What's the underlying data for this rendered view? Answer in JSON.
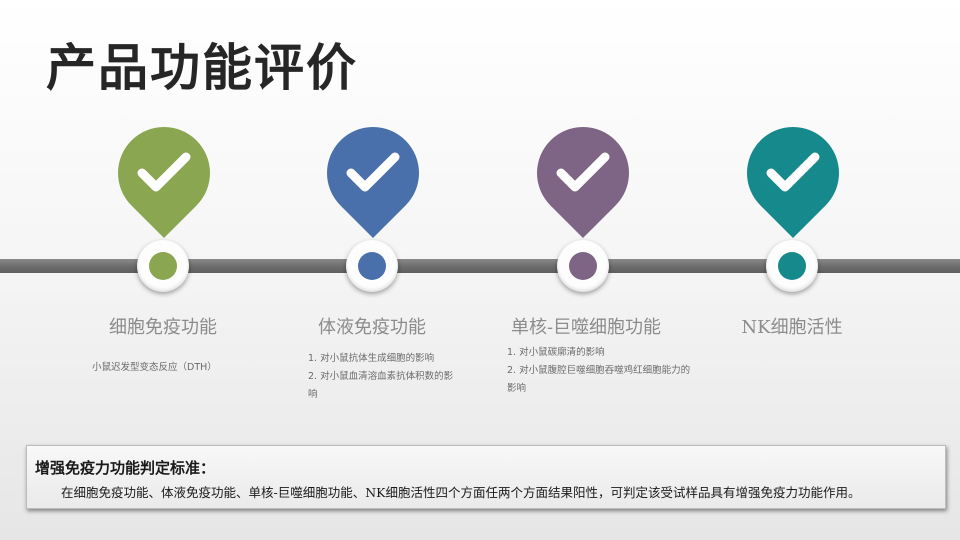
{
  "title": "产品功能评价",
  "features": [
    {
      "title": "细胞免疫功能",
      "color": "#8aa651",
      "icon": "checkmark-icon",
      "details": [
        "小鼠迟发型变态反应（DTH）"
      ]
    },
    {
      "title": "体液免疫功能",
      "color": "#4a70ab",
      "icon": "checkmark-icon",
      "details": [
        "1.  对小鼠抗体生成细胞的影响",
        "2.  对小鼠血清溶血素抗体积数的影响"
      ]
    },
    {
      "title": "单核-巨噬细胞功能",
      "color": "#7e6485",
      "icon": "checkmark-icon",
      "details": [
        "1.  对小鼠碳廓清的影响",
        "2.  对小鼠腹腔巨噬细胞吞噬鸡红细胞能力的影响"
      ]
    },
    {
      "title": "NK细胞活性",
      "color": "#15898c",
      "icon": "checkmark-icon",
      "details": []
    }
  ],
  "criteria": {
    "title": "增强免疫力功能判定标准：",
    "text": "在细胞免疫功能、体液免疫功能、单核-巨噬细胞功能、NK细胞活性四个方面任两个方面结果阳性，可判定该受试样品具有增强免疫力功能作用。"
  }
}
